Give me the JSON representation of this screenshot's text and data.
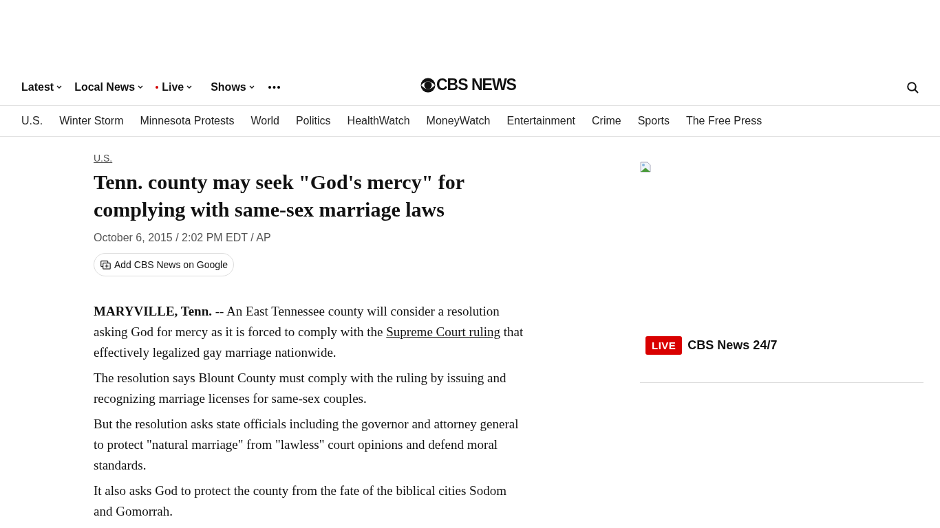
{
  "main_nav": [
    {
      "label": "Latest",
      "kind": "dropdown"
    },
    {
      "label": "Local News",
      "kind": "dropdown"
    },
    {
      "label": "Live",
      "kind": "live-dropdown"
    },
    {
      "label": "Shows",
      "kind": "dropdown"
    }
  ],
  "logo": {
    "text": "CBS NEWS"
  },
  "section_nav": [
    "U.S.",
    "Winter Storm",
    "Minnesota Protests",
    "World",
    "Politics",
    "HealthWatch",
    "MoneyWatch",
    "Entertainment",
    "Crime",
    "Sports",
    "The Free Press"
  ],
  "article": {
    "section": "U.S.",
    "headline": "Tenn. county may seek \"God's mercy\" for complying with same-sex marriage laws",
    "byline": "October 6, 2015 / 2:02 PM EDT / AP",
    "google_button": "Add CBS News on Google",
    "paragraphs": [
      [
        {
          "kind": "bold",
          "text": "MARYVILLE, Tenn."
        },
        {
          "kind": "plain",
          "text": " -- An East Tennessee county will consider a resolution asking God for mercy as it is forced to comply with the "
        },
        {
          "kind": "link",
          "text": "Supreme Court ruling"
        },
        {
          "kind": "plain",
          "text": " that effectively legalized gay marriage nationwide."
        }
      ],
      [
        {
          "kind": "plain",
          "text": "The resolution says Blount County must comply with the ruling by issuing and recognizing marriage licenses for same-sex couples."
        }
      ],
      [
        {
          "kind": "plain",
          "text": "But the resolution asks state officials including the governor and attorney general to protect \"natural marriage\" from \"lawless\" court opinions and defend moral standards."
        }
      ],
      [
        {
          "kind": "plain",
          "text": "It also asks God to protect the county from the fate of the biblical cities Sodom and Gomorrah."
        }
      ]
    ]
  },
  "sidebar": {
    "live_badge": "LIVE",
    "live_title": "CBS News 24/7"
  }
}
